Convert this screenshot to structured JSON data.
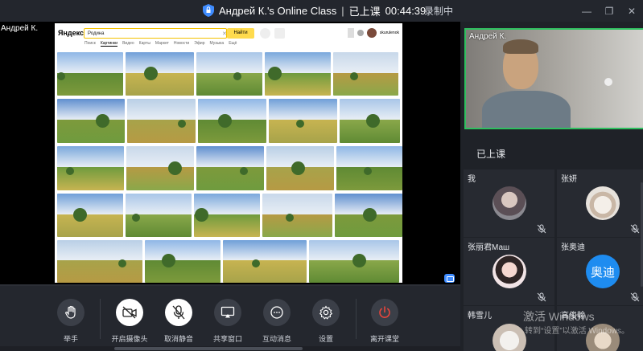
{
  "titlebar": {
    "title": "Андрей К.'s Online Class",
    "status": "已上课",
    "timer": "00:44:39",
    "recording": "录制中",
    "window_buttons": {
      "minimize": "—",
      "restore": "❐",
      "close": "✕"
    }
  },
  "stage": {
    "presenter_name": "Андрей К.",
    "browser": {
      "logo": "Яндекс",
      "search_value": "Родина",
      "search_button": "Найти",
      "user_name": "skurulenok",
      "tabs": [
        "Поиск",
        "Картинки",
        "Видео",
        "Карты",
        "Маркет",
        "Новости",
        "Эфир",
        "Музыка",
        "Ещё"
      ],
      "active_tab": "Картинки"
    }
  },
  "toolbar": {
    "buttons": [
      {
        "label": "举手",
        "icon": "hand-icon"
      },
      {
        "label": "开启摄像头",
        "icon": "camera-off-icon"
      },
      {
        "label": "取消静音",
        "icon": "mic-off-icon"
      },
      {
        "label": "共享窗口",
        "icon": "share-screen-icon"
      },
      {
        "label": "互动消息",
        "icon": "chat-bubble-icon"
      },
      {
        "label": "设置",
        "icon": "gear-icon"
      },
      {
        "label": "离开课堂",
        "icon": "power-icon"
      }
    ]
  },
  "rightpanel": {
    "teacher_name": "Андрей К.",
    "class_status": "已上课",
    "students": [
      {
        "name": "我",
        "avatar": "photo-avatar"
      },
      {
        "name": "张妍",
        "avatar": "cat-avatar"
      },
      {
        "name": "张丽君Маш",
        "avatar": "girl-avatar"
      },
      {
        "name": "张奥迪",
        "avatar_text": "奥迪"
      },
      {
        "name": "韩雪儿",
        "avatar": "cat-avatar"
      },
      {
        "name": "高俊翰",
        "avatar": "photo-avatar"
      }
    ]
  },
  "os_overlay": {
    "activate_title": "激活 Windows",
    "activate_sub": "转到“设置”以激活 Windows。"
  },
  "colors": {
    "active_speaker_border": "#2fbf5f",
    "leave_red": "#e8453c",
    "accent_blue": "#1e8cf0"
  }
}
